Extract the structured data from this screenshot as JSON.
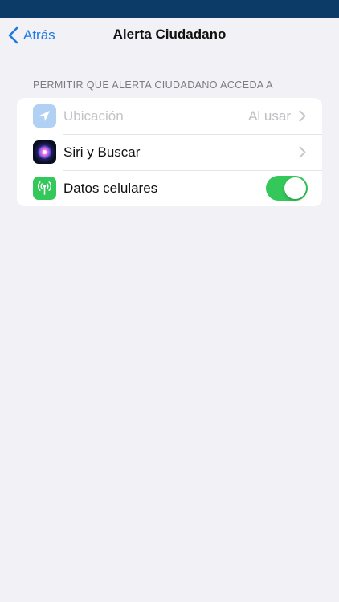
{
  "nav": {
    "back_label": "Atrás",
    "title": "Alerta Ciudadano"
  },
  "section": {
    "header": "PERMITIR QUE ALERTA CIUDADANO ACCEDA A"
  },
  "rows": [
    {
      "label": "Ubicación",
      "value": "Al usar",
      "icon": "location-arrow-icon",
      "enabled": false
    },
    {
      "label": "Siri y Buscar",
      "icon": "siri-icon",
      "enabled": true
    },
    {
      "label": "Datos celulares",
      "icon": "cellular-antenna-icon",
      "toggle_on": true
    }
  ],
  "colors": {
    "status_bar": "#0b3b66",
    "accent": "#1f7ae0",
    "toggle_on": "#34c759",
    "background": "#f1f1f6"
  }
}
